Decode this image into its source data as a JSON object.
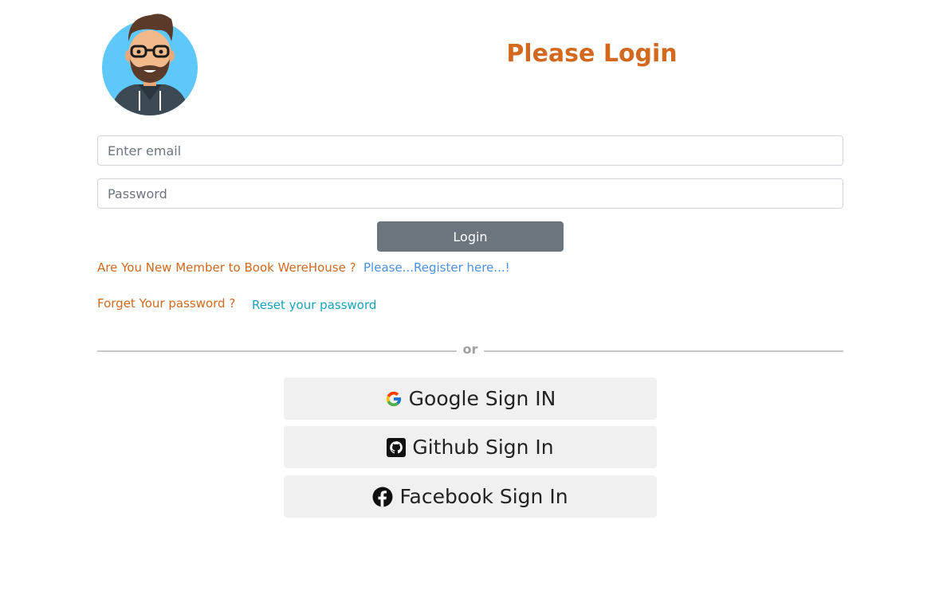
{
  "header": {
    "title": "Please Login"
  },
  "form": {
    "email_placeholder": "Enter email",
    "password_placeholder": "Password",
    "login_label": "Login"
  },
  "links": {
    "new_member_text": "Are You New Member to Book WereHouse ?",
    "register_text": "Please...Register here...!",
    "forgot_text": "Forget Your password ?",
    "reset_text": "Reset your password"
  },
  "divider": {
    "text": "or"
  },
  "social": {
    "google_label": "Google Sign IN",
    "github_label": "Github Sign In",
    "facebook_label": "Facebook Sign In"
  },
  "icons": {
    "avatar": "user-avatar-icon",
    "google": "google-icon",
    "github": "github-icon",
    "facebook": "facebook-icon"
  },
  "colors": {
    "title": "#d2691e",
    "register_link": "#4a90e2",
    "reset_link": "#17a2b8",
    "login_button": "#6c757d",
    "social_button_bg": "#f0f0f0"
  }
}
